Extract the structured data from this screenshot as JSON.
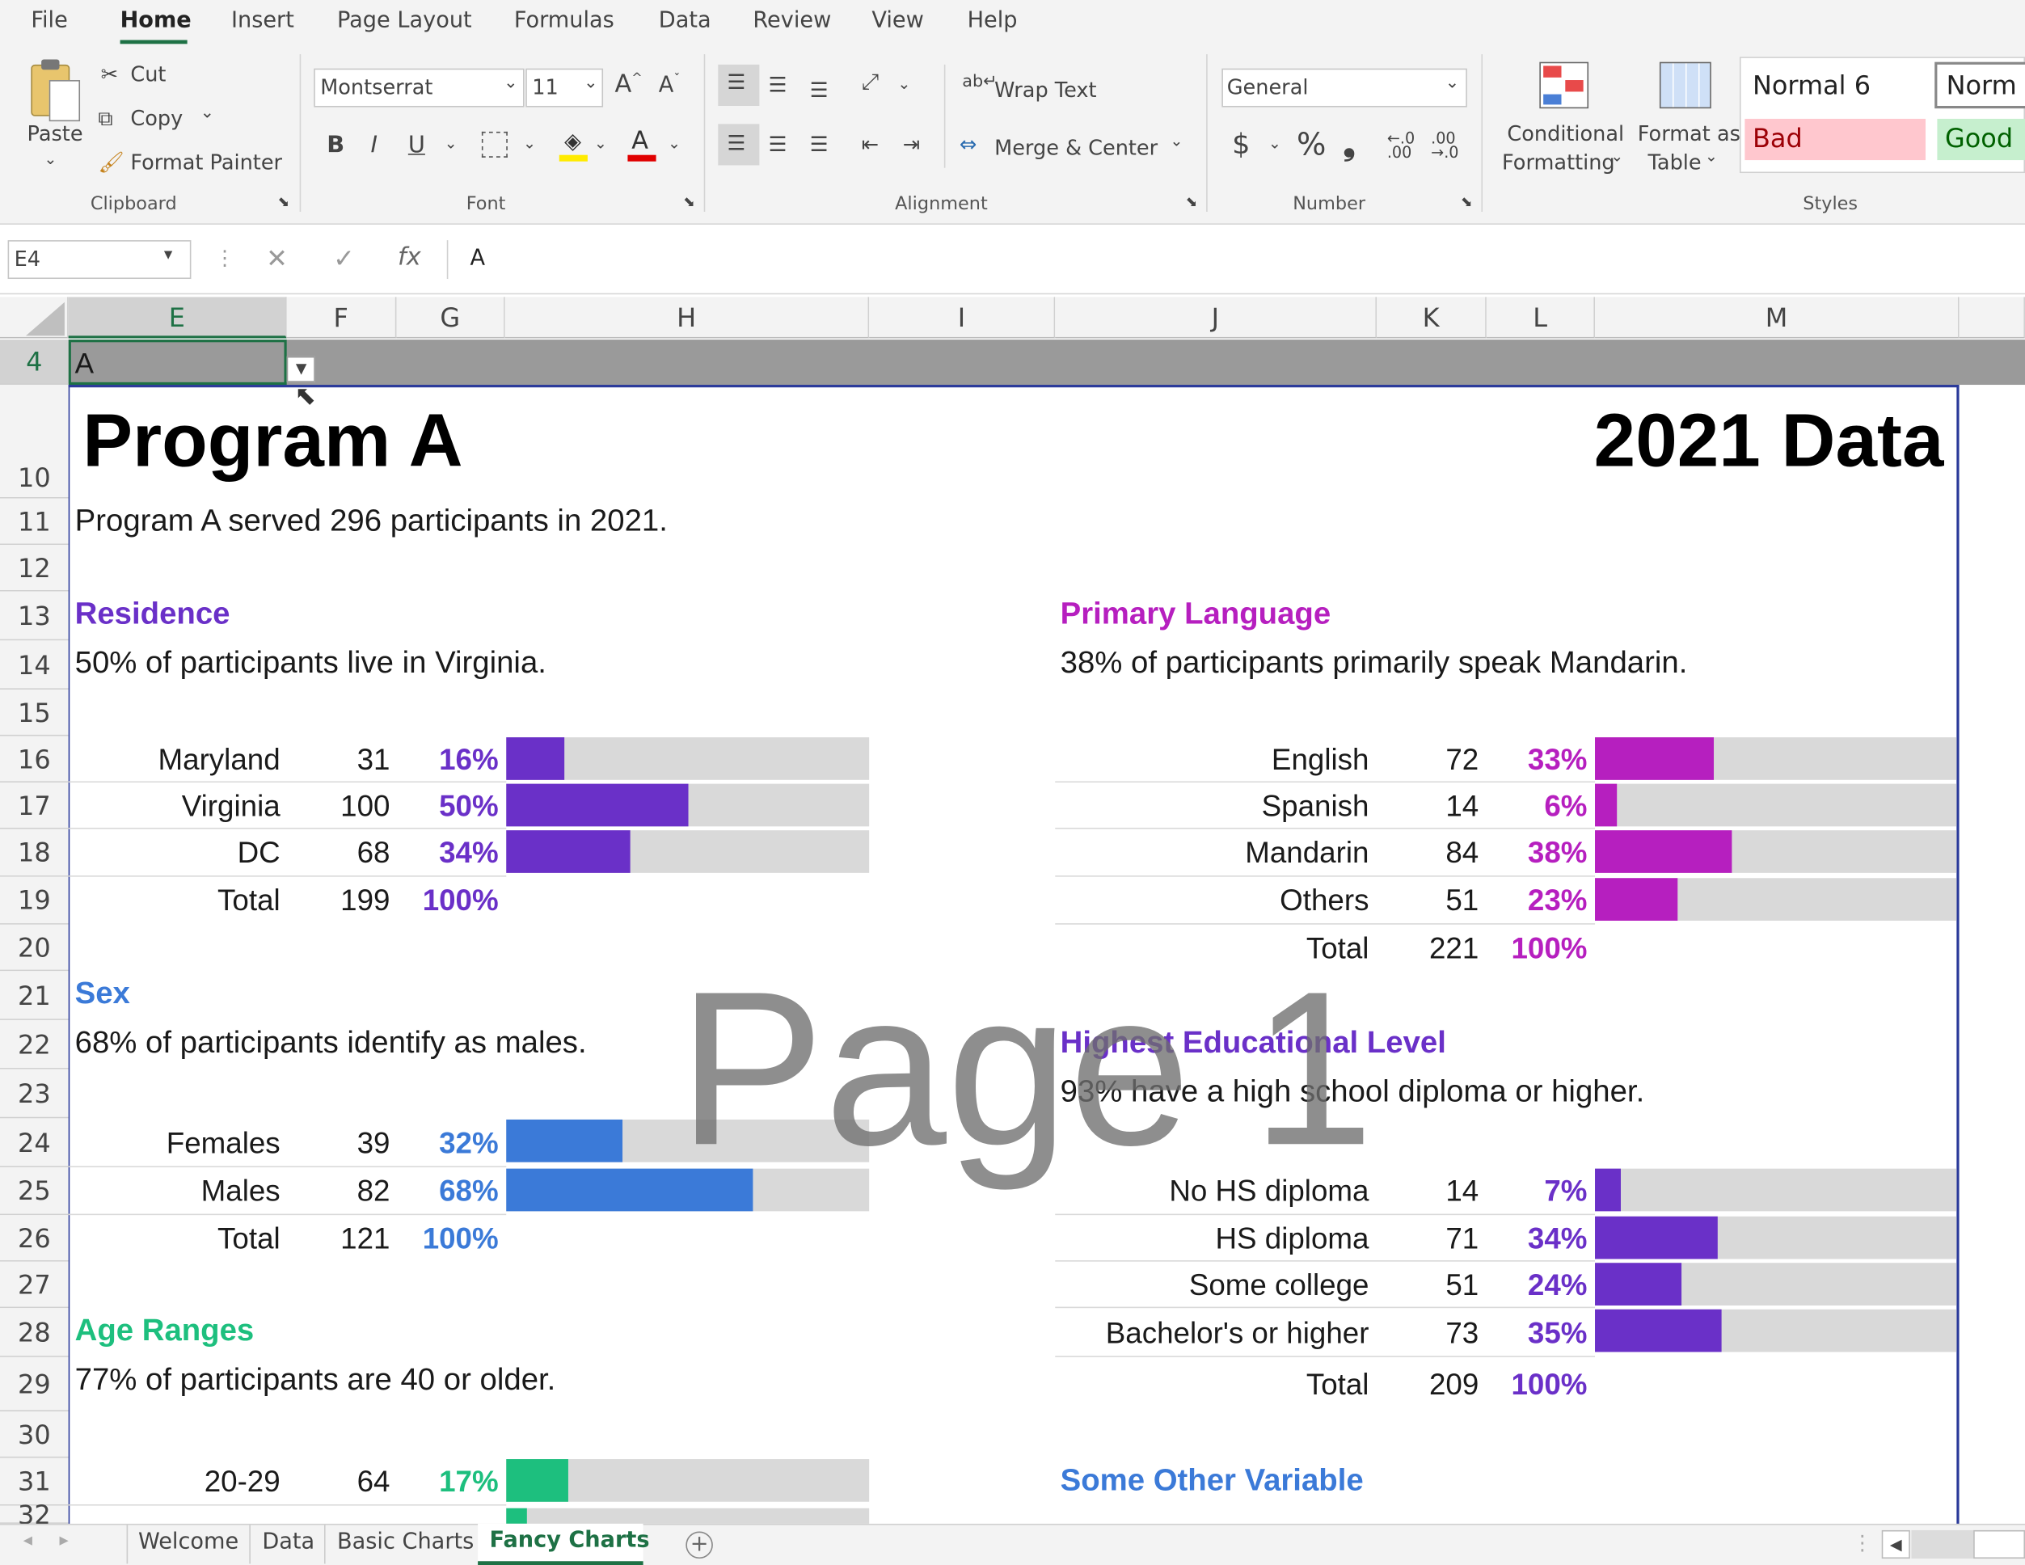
{
  "menu": {
    "file": "File",
    "home": "Home",
    "insert": "Insert",
    "page_layout": "Page Layout",
    "formulas": "Formulas",
    "data": "Data",
    "review": "Review",
    "view": "View",
    "help": "Help"
  },
  "ribbon": {
    "clipboard": {
      "paste": "Paste",
      "cut": "Cut",
      "copy": "Copy",
      "format_painter": "Format Painter",
      "label": "Clipboard"
    },
    "font": {
      "name": "Montserrat",
      "size": "11",
      "label": "Font",
      "bold": "B",
      "italic": "I",
      "underline": "U"
    },
    "alignment": {
      "wrap_text": "Wrap Text",
      "merge_center": "Merge & Center",
      "label": "Alignment"
    },
    "number": {
      "format": "General",
      "label": "Number",
      "dollar": "$",
      "percent": "%",
      "comma": "❟"
    },
    "styles": {
      "conditional_1": "Conditional",
      "conditional_2": "Formatting",
      "format_table_1": "Format as",
      "format_table_2": "Table",
      "normal6": "Normal 6",
      "normal": "Norm",
      "bad": "Bad",
      "good": "Good",
      "label": "Styles"
    }
  },
  "formula_bar": {
    "name_box": "E4",
    "fx": "fx",
    "content": "A"
  },
  "columns": [
    "E",
    "F",
    "G",
    "H",
    "I",
    "J",
    "K",
    "L",
    "M"
  ],
  "rows": [
    "4",
    "10",
    "11",
    "12",
    "13",
    "14",
    "15",
    "16",
    "17",
    "18",
    "19",
    "20",
    "21",
    "22",
    "23",
    "24",
    "25",
    "26",
    "27",
    "28",
    "29",
    "30",
    "31",
    "32"
  ],
  "cell_e4": "A",
  "sheet": {
    "title": "Program A",
    "year": "2021 Data",
    "summary": "Program A served 296 participants in 2021.",
    "watermark": "Page 1",
    "residence": {
      "title": "Residence",
      "desc": "50% of participants live in Virginia.",
      "color": "#6a30c8",
      "rows": [
        {
          "label": "Maryland",
          "n": "31",
          "pct": "16%",
          "v": 0.16
        },
        {
          "label": "Virginia",
          "n": "100",
          "pct": "50%",
          "v": 0.5
        },
        {
          "label": "DC",
          "n": "68",
          "pct": "34%",
          "v": 0.34
        }
      ],
      "total": {
        "label": "Total",
        "n": "199",
        "pct": "100%"
      }
    },
    "sex": {
      "title": "Sex",
      "desc": "68% of participants identify as males.",
      "color": "#3b7ad8",
      "rows": [
        {
          "label": "Females",
          "n": "39",
          "pct": "32%",
          "v": 0.32
        },
        {
          "label": "Males",
          "n": "82",
          "pct": "68%",
          "v": 0.68
        }
      ],
      "total": {
        "label": "Total",
        "n": "121",
        "pct": "100%"
      }
    },
    "age": {
      "title": "Age Ranges",
      "desc": "77% of participants are 40 or older.",
      "color": "#1dbf7e",
      "rows": [
        {
          "label": "20-29",
          "n": "64",
          "pct": "17%",
          "v": 0.17
        }
      ]
    },
    "language": {
      "title": "Primary Language",
      "desc": "38% of participants primarily speak Mandarin.",
      "color": "#b61fbf",
      "rows": [
        {
          "label": "English",
          "n": "72",
          "pct": "33%",
          "v": 0.33
        },
        {
          "label": "Spanish",
          "n": "14",
          "pct": "6%",
          "v": 0.06
        },
        {
          "label": "Mandarin",
          "n": "84",
          "pct": "38%",
          "v": 0.38
        },
        {
          "label": "Others",
          "n": "51",
          "pct": "23%",
          "v": 0.23
        }
      ],
      "total": {
        "label": "Total",
        "n": "221",
        "pct": "100%"
      }
    },
    "education": {
      "title": "Highest Educational Level",
      "desc": "93% have a high school diploma or higher.",
      "color": "#6a30c8",
      "rows": [
        {
          "label": "No HS diploma",
          "n": "14",
          "pct": "7%",
          "v": 0.07
        },
        {
          "label": "HS diploma",
          "n": "71",
          "pct": "34%",
          "v": 0.34
        },
        {
          "label": "Some college",
          "n": "51",
          "pct": "24%",
          "v": 0.24
        },
        {
          "label": "Bachelor's or higher",
          "n": "73",
          "pct": "35%",
          "v": 0.35
        }
      ],
      "total": {
        "label": "Total",
        "n": "209",
        "pct": "100%"
      }
    },
    "other": {
      "title": "Some Other Variable",
      "color": "#3b7ad8"
    }
  },
  "sheet_tabs": [
    "Welcome",
    "Data",
    "Basic Charts",
    "Fancy Charts"
  ],
  "active_tab": "Fancy Charts"
}
